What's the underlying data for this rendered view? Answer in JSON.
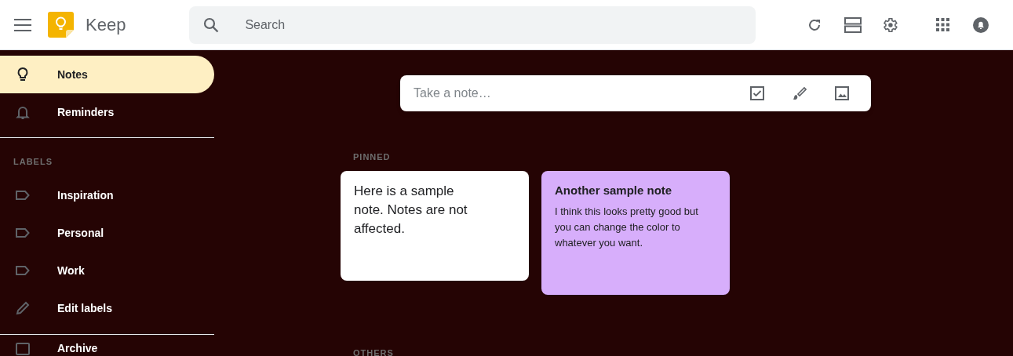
{
  "header": {
    "app_name": "Keep",
    "search": {
      "placeholder": "Search"
    }
  },
  "sidebar": {
    "items": [
      {
        "kind": "bulb",
        "label": "Notes",
        "selected": true
      },
      {
        "kind": "bell",
        "label": "Reminders",
        "selected": false
      },
      {
        "kind": "heading",
        "label": "LABELS"
      },
      {
        "kind": "label",
        "label": "Inspiration",
        "selected": false
      },
      {
        "kind": "label",
        "label": "Personal",
        "selected": false
      },
      {
        "kind": "label",
        "label": "Work",
        "selected": false
      },
      {
        "kind": "pencil",
        "label": "Edit labels",
        "selected": false
      },
      {
        "kind": "archive",
        "label": "Archive",
        "selected": false
      }
    ]
  },
  "composer": {
    "placeholder": "Take a note…"
  },
  "sections": [
    {
      "heading": "PINNED",
      "notes": [
        {
          "body": "Here is a sample note. Notes are not affected.",
          "color": "#ffffff"
        },
        {
          "title": "Another sample note",
          "body": "I think this looks pretty good but you can change the color to whatever you want.",
          "color": "#d7aefb"
        }
      ]
    },
    {
      "heading": "OTHERS"
    }
  ]
}
